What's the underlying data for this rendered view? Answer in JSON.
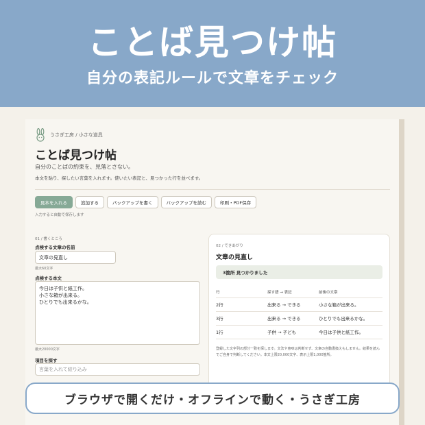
{
  "banner": {
    "title": "ことば見つけ帖",
    "subtitle": "自分の表記ルールで文章をチェック"
  },
  "app": {
    "brand": "うさぎ工房 / 小さな道具",
    "title": "ことば見つけ帖",
    "tagline": "自分のことばの約束を、見落とさない。",
    "description": "本文を貼り、探したい言葉を入れます。使いたい表記と、見つかった行を並べます。",
    "toolbar": {
      "sample": "見本を入れる",
      "add": "追加する",
      "backup_write": "バックアップを書く",
      "backup_read": "バックアップを読む",
      "print": "印刷・PDF保存"
    },
    "autosave_note": "入力すると自動で保存します"
  },
  "left": {
    "section": "01 / 書くところ",
    "name_label": "点検する文章の名前",
    "name_value": "文章の見直し",
    "name_hint": "最大60文字",
    "body_label": "点検する本文",
    "body_lines": [
      "今日は子供と紙工作。",
      "小さな箱が出来る。",
      "ひとりでも出来るかな。"
    ],
    "body_hint": "最大20000文字",
    "filter_label": "項目を探す",
    "filter_placeholder": "言葉を入れて絞り込み"
  },
  "result": {
    "section": "02 / できあがり",
    "title": "文章の見直し",
    "summary": "3箇所 見つかりました",
    "headers": [
      "行",
      "探す語 → 表記",
      "前後の文章"
    ],
    "rows": [
      [
        "2行",
        "出来る → できる",
        "小さな箱が出来る。"
      ],
      [
        "3行",
        "出来る → できる",
        "ひとりでも出来るかな。"
      ],
      [
        "1行",
        "子供 → 子ども",
        "今日は子供と紙工作。"
      ]
    ],
    "note": "登録した文字列の部分一致を探します。文法や意味は判断せず、文章の自動書換えもしません。結果を読んでご自身で判断してください。本文上限20,000文字、表示上限1,000箇所。"
  },
  "footer": "ブラウザで開くだけ・オフラインで動く・うさぎ工房",
  "colors": {
    "banner": "#88a8c9",
    "primary_button": "#86a996",
    "summary_bg": "#eaeee6"
  },
  "icons": {
    "brand": "rabbit-icon"
  }
}
